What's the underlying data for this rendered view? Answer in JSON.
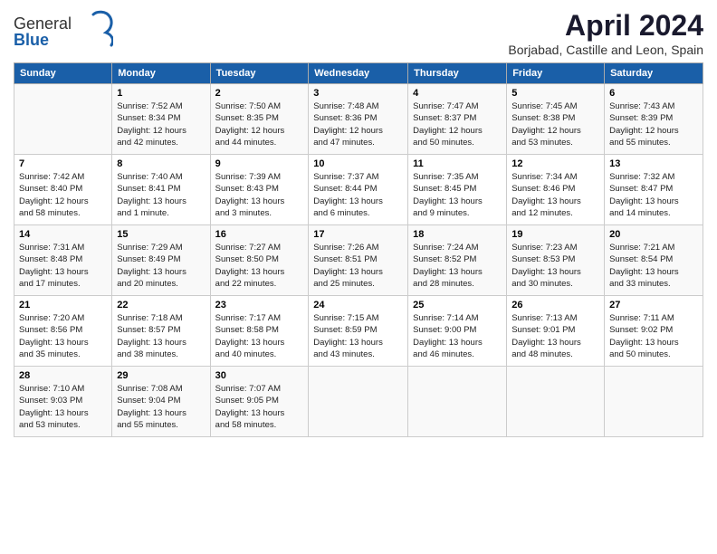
{
  "logo": {
    "general": "General",
    "blue": "Blue"
  },
  "title": "April 2024",
  "subtitle": "Borjabad, Castille and Leon, Spain",
  "header_days": [
    "Sunday",
    "Monday",
    "Tuesday",
    "Wednesday",
    "Thursday",
    "Friday",
    "Saturday"
  ],
  "weeks": [
    [
      {
        "day": "",
        "info": ""
      },
      {
        "day": "1",
        "info": "Sunrise: 7:52 AM\nSunset: 8:34 PM\nDaylight: 12 hours\nand 42 minutes."
      },
      {
        "day": "2",
        "info": "Sunrise: 7:50 AM\nSunset: 8:35 PM\nDaylight: 12 hours\nand 44 minutes."
      },
      {
        "day": "3",
        "info": "Sunrise: 7:48 AM\nSunset: 8:36 PM\nDaylight: 12 hours\nand 47 minutes."
      },
      {
        "day": "4",
        "info": "Sunrise: 7:47 AM\nSunset: 8:37 PM\nDaylight: 12 hours\nand 50 minutes."
      },
      {
        "day": "5",
        "info": "Sunrise: 7:45 AM\nSunset: 8:38 PM\nDaylight: 12 hours\nand 53 minutes."
      },
      {
        "day": "6",
        "info": "Sunrise: 7:43 AM\nSunset: 8:39 PM\nDaylight: 12 hours\nand 55 minutes."
      }
    ],
    [
      {
        "day": "7",
        "info": "Sunrise: 7:42 AM\nSunset: 8:40 PM\nDaylight: 12 hours\nand 58 minutes."
      },
      {
        "day": "8",
        "info": "Sunrise: 7:40 AM\nSunset: 8:41 PM\nDaylight: 13 hours\nand 1 minute."
      },
      {
        "day": "9",
        "info": "Sunrise: 7:39 AM\nSunset: 8:43 PM\nDaylight: 13 hours\nand 3 minutes."
      },
      {
        "day": "10",
        "info": "Sunrise: 7:37 AM\nSunset: 8:44 PM\nDaylight: 13 hours\nand 6 minutes."
      },
      {
        "day": "11",
        "info": "Sunrise: 7:35 AM\nSunset: 8:45 PM\nDaylight: 13 hours\nand 9 minutes."
      },
      {
        "day": "12",
        "info": "Sunrise: 7:34 AM\nSunset: 8:46 PM\nDaylight: 13 hours\nand 12 minutes."
      },
      {
        "day": "13",
        "info": "Sunrise: 7:32 AM\nSunset: 8:47 PM\nDaylight: 13 hours\nand 14 minutes."
      }
    ],
    [
      {
        "day": "14",
        "info": "Sunrise: 7:31 AM\nSunset: 8:48 PM\nDaylight: 13 hours\nand 17 minutes."
      },
      {
        "day": "15",
        "info": "Sunrise: 7:29 AM\nSunset: 8:49 PM\nDaylight: 13 hours\nand 20 minutes."
      },
      {
        "day": "16",
        "info": "Sunrise: 7:27 AM\nSunset: 8:50 PM\nDaylight: 13 hours\nand 22 minutes."
      },
      {
        "day": "17",
        "info": "Sunrise: 7:26 AM\nSunset: 8:51 PM\nDaylight: 13 hours\nand 25 minutes."
      },
      {
        "day": "18",
        "info": "Sunrise: 7:24 AM\nSunset: 8:52 PM\nDaylight: 13 hours\nand 28 minutes."
      },
      {
        "day": "19",
        "info": "Sunrise: 7:23 AM\nSunset: 8:53 PM\nDaylight: 13 hours\nand 30 minutes."
      },
      {
        "day": "20",
        "info": "Sunrise: 7:21 AM\nSunset: 8:54 PM\nDaylight: 13 hours\nand 33 minutes."
      }
    ],
    [
      {
        "day": "21",
        "info": "Sunrise: 7:20 AM\nSunset: 8:56 PM\nDaylight: 13 hours\nand 35 minutes."
      },
      {
        "day": "22",
        "info": "Sunrise: 7:18 AM\nSunset: 8:57 PM\nDaylight: 13 hours\nand 38 minutes."
      },
      {
        "day": "23",
        "info": "Sunrise: 7:17 AM\nSunset: 8:58 PM\nDaylight: 13 hours\nand 40 minutes."
      },
      {
        "day": "24",
        "info": "Sunrise: 7:15 AM\nSunset: 8:59 PM\nDaylight: 13 hours\nand 43 minutes."
      },
      {
        "day": "25",
        "info": "Sunrise: 7:14 AM\nSunset: 9:00 PM\nDaylight: 13 hours\nand 46 minutes."
      },
      {
        "day": "26",
        "info": "Sunrise: 7:13 AM\nSunset: 9:01 PM\nDaylight: 13 hours\nand 48 minutes."
      },
      {
        "day": "27",
        "info": "Sunrise: 7:11 AM\nSunset: 9:02 PM\nDaylight: 13 hours\nand 50 minutes."
      }
    ],
    [
      {
        "day": "28",
        "info": "Sunrise: 7:10 AM\nSunset: 9:03 PM\nDaylight: 13 hours\nand 53 minutes."
      },
      {
        "day": "29",
        "info": "Sunrise: 7:08 AM\nSunset: 9:04 PM\nDaylight: 13 hours\nand 55 minutes."
      },
      {
        "day": "30",
        "info": "Sunrise: 7:07 AM\nSunset: 9:05 PM\nDaylight: 13 hours\nand 58 minutes."
      },
      {
        "day": "",
        "info": ""
      },
      {
        "day": "",
        "info": ""
      },
      {
        "day": "",
        "info": ""
      },
      {
        "day": "",
        "info": ""
      }
    ]
  ]
}
